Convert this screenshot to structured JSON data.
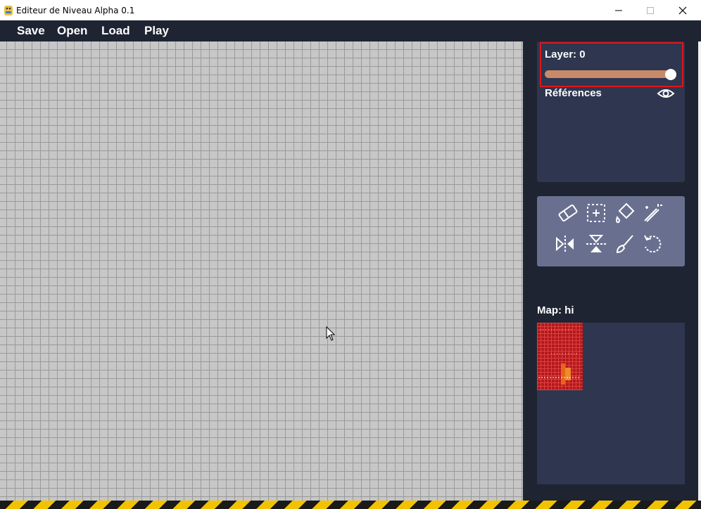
{
  "window": {
    "title": "Editeur de Niveau Alpha 0.1"
  },
  "menu": {
    "items": [
      "Save",
      "Open",
      "Load",
      "Play"
    ]
  },
  "layers": {
    "label": "Layer: 0",
    "slider_fraction": 1.0,
    "references_label": "Références"
  },
  "tools": [
    {
      "icon": "eraser-icon"
    },
    {
      "icon": "select-icon"
    },
    {
      "icon": "fill-icon"
    },
    {
      "icon": "magic-wand-icon"
    },
    {
      "icon": "flip-horizontal-icon"
    },
    {
      "icon": "flip-vertical-icon"
    },
    {
      "icon": "brush-icon"
    },
    {
      "icon": "rotate-icon"
    }
  ],
  "map": {
    "label": "Map: hi"
  },
  "colors": {
    "background": "#1f2433",
    "panel": "#2f3650",
    "tools_panel": "#69708f",
    "slider": "#c98a6a",
    "highlight": "#e0161a"
  }
}
